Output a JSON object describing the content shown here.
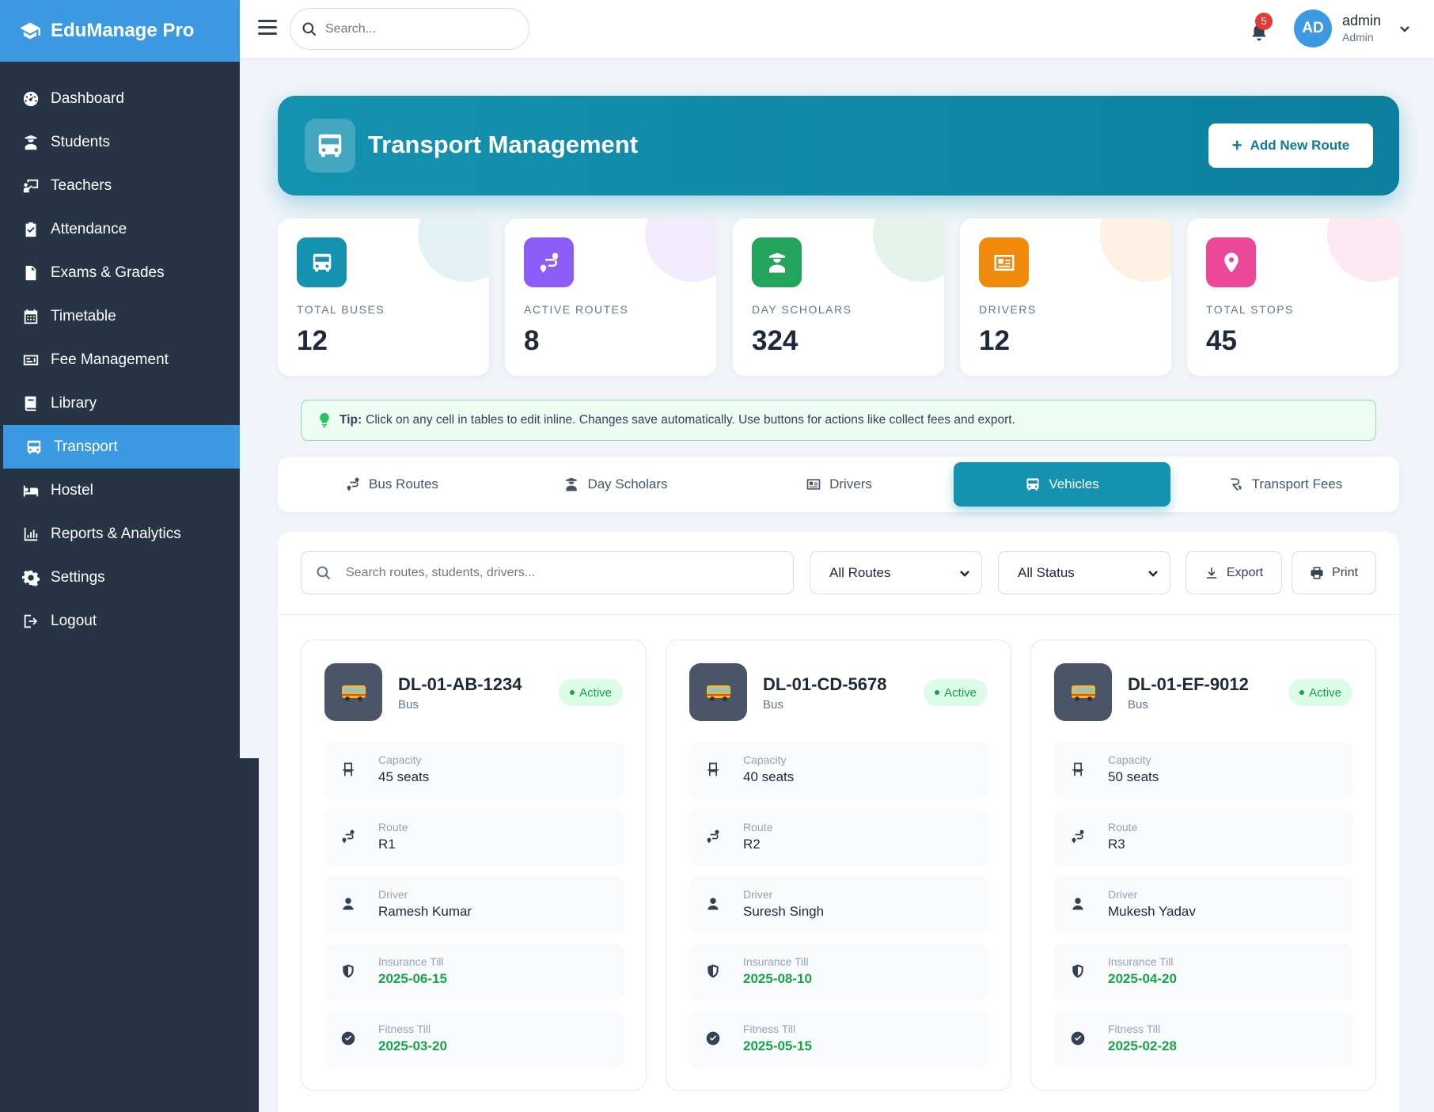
{
  "app": {
    "title": "EduManage Pro"
  },
  "sidebar": {
    "items": [
      {
        "label": "Dashboard",
        "icon": "dashboard-icon"
      },
      {
        "label": "Students",
        "icon": "student-icon"
      },
      {
        "label": "Teachers",
        "icon": "teacher-icon"
      },
      {
        "label": "Attendance",
        "icon": "clipboard-check-icon"
      },
      {
        "label": "Exams & Grades",
        "icon": "document-icon"
      },
      {
        "label": "Timetable",
        "icon": "calendar-icon"
      },
      {
        "label": "Fee Management",
        "icon": "money-icon"
      },
      {
        "label": "Library",
        "icon": "book-icon"
      },
      {
        "label": "Transport",
        "icon": "bus-icon",
        "active": true
      },
      {
        "label": "Hostel",
        "icon": "bed-icon"
      },
      {
        "label": "Reports & Analytics",
        "icon": "chart-icon"
      },
      {
        "label": "Settings",
        "icon": "gear-icon"
      },
      {
        "label": "Logout",
        "icon": "logout-icon"
      }
    ]
  },
  "topbar": {
    "search_placeholder": "Search...",
    "notifications": "5",
    "avatar_initials": "AD",
    "user_name": "admin",
    "user_role": "Admin"
  },
  "hero": {
    "title": "Transport Management",
    "add_button": "Add New Route"
  },
  "stats": [
    {
      "label": "TOTAL BUSES",
      "value": "12",
      "color": "#1592b0",
      "icon": "bus-icon"
    },
    {
      "label": "ACTIVE ROUTES",
      "value": "8",
      "color": "#8b5cf6",
      "icon": "route-icon"
    },
    {
      "label": "DAY SCHOLARS",
      "value": "324",
      "color": "#22a45d",
      "icon": "student-icon"
    },
    {
      "label": "DRIVERS",
      "value": "12",
      "color": "#f08a0c",
      "icon": "id-card-icon"
    },
    {
      "label": "TOTAL STOPS",
      "value": "45",
      "color": "#ec4899",
      "icon": "map-pin-icon"
    }
  ],
  "tip": {
    "label": "Tip:",
    "text": "Click on any cell in tables to edit inline. Changes save automatically. Use buttons for actions like collect fees and export."
  },
  "tabs": [
    {
      "label": "Bus Routes",
      "icon": "route-icon"
    },
    {
      "label": "Day Scholars",
      "icon": "student-icon"
    },
    {
      "label": "Drivers",
      "icon": "id-card-icon"
    },
    {
      "label": "Vehicles",
      "icon": "bus-icon",
      "active": true
    },
    {
      "label": "Transport Fees",
      "icon": "rupee-icon"
    }
  ],
  "filters": {
    "search_placeholder": "Search routes, students, drivers...",
    "routes_select": "All Routes",
    "status_select": "All Status",
    "export_label": "Export",
    "print_label": "Print"
  },
  "vehicles": [
    {
      "plate": "DL-01-AB-1234",
      "type": "Bus",
      "status": "Active",
      "capacity_label": "Capacity",
      "capacity": "45 seats",
      "route_label": "Route",
      "route": "R1",
      "driver_label": "Driver",
      "driver": "Ramesh Kumar",
      "insurance_label": "Insurance Till",
      "insurance": "2025-06-15",
      "fitness_label": "Fitness Till",
      "fitness": "2025-03-20"
    },
    {
      "plate": "DL-01-CD-5678",
      "type": "Bus",
      "status": "Active",
      "capacity_label": "Capacity",
      "capacity": "40 seats",
      "route_label": "Route",
      "route": "R2",
      "driver_label": "Driver",
      "driver": "Suresh Singh",
      "insurance_label": "Insurance Till",
      "insurance": "2025-08-10",
      "fitness_label": "Fitness Till",
      "fitness": "2025-05-15"
    },
    {
      "plate": "DL-01-EF-9012",
      "type": "Bus",
      "status": "Active",
      "capacity_label": "Capacity",
      "capacity": "50 seats",
      "route_label": "Route",
      "route": "R3",
      "driver_label": "Driver",
      "driver": "Mukesh Yadav",
      "insurance_label": "Insurance Till",
      "insurance": "2025-04-20",
      "fitness_label": "Fitness Till",
      "fitness": "2025-02-28"
    }
  ],
  "colors": {
    "sidebar_bg": "#263445",
    "accent": "#3b9ae1",
    "teal": "#1592b0",
    "success": "#16a34a"
  }
}
